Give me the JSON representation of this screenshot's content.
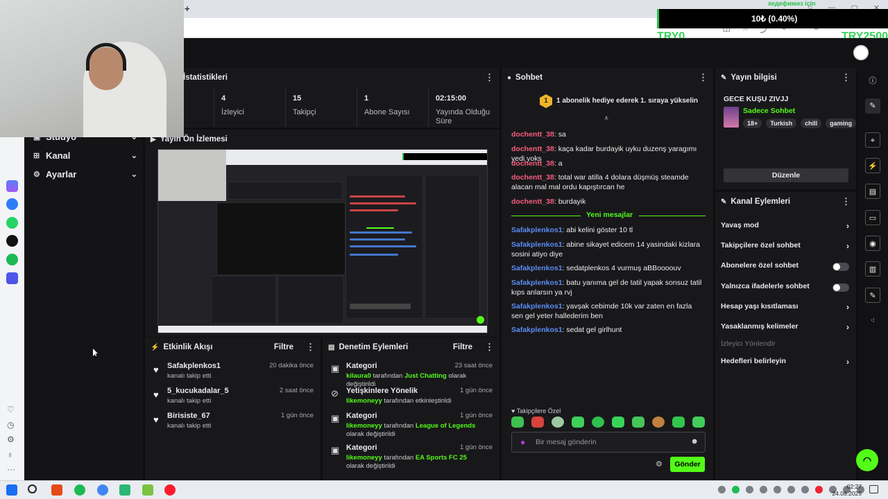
{
  "overlay": {
    "goal_label": "хедефимиз için",
    "amount": "10₺ (0.40%)",
    "min": "TRY0",
    "max": "TRY2500"
  },
  "nav": {
    "items": [
      {
        "label": "Studyo"
      },
      {
        "label": "Kanal"
      },
      {
        "label": "Ayarlar"
      }
    ]
  },
  "stats": {
    "title": "İstatistikleri",
    "items": [
      {
        "value": "4",
        "label": "İzleyici"
      },
      {
        "value": "15",
        "label": "Takipçi"
      },
      {
        "value": "1",
        "label": "Abone Sayısı"
      },
      {
        "value": "02:15:00",
        "label": "Yayında Olduğu Süre"
      }
    ]
  },
  "preview": {
    "title": "Yayın Ön İzlemesi"
  },
  "activity": {
    "title": "Etkinlik Akışı",
    "filter": "Filtre",
    "items": [
      {
        "name": "Safakplenkos1",
        "sub": "kanalı takip etti",
        "time": "20 dakika önce"
      },
      {
        "name": "5_kucukadalar_5",
        "sub": "kanalı takip etti",
        "time": "2 saat önce"
      },
      {
        "name": "Birisiste_67",
        "sub": "kanalı takip etti",
        "time": "1 gün önce"
      }
    ]
  },
  "moderation": {
    "title": "Denetim Eylemleri",
    "filter": "Filtre",
    "items": [
      {
        "title": "Kategori",
        "user": "kilaura0",
        "mid": "tarafından",
        "target": "Just Chatting",
        "end": "olarak değiştirildi",
        "time": "23 saat önce"
      },
      {
        "title": "Yetişkinlere Yönelik",
        "user": "likemoneyy",
        "mid": "tarafından etkinleştirildi",
        "target": "",
        "end": "",
        "time": "1 gün önce"
      },
      {
        "title": "Kategori",
        "user": "likemoneyy",
        "mid": "tarafından",
        "target": "League of Legends",
        "end": "olarak değiştirildi",
        "time": "1 gün önce"
      },
      {
        "title": "Kategori",
        "user": "likemoneyy",
        "mid": "tarafından",
        "target": "EA Sports FC 25",
        "end": "olarak değiştirildi",
        "time": "1 gün önce"
      }
    ]
  },
  "chat": {
    "title": "Sohbet",
    "gift_count": "1",
    "gift_text": "1 abonelik hediye ederek 1. sıraya yükselin",
    "new_messages": "Yeni mesajlar",
    "messages_old": [
      {
        "user": "dochentt_38",
        "text": ": sa"
      },
      {
        "user": "dochentt_38",
        "text": ": kaça kadar burdayik uyku duzenş yaragımı yedi yoks"
      },
      {
        "user": "dochentt_38",
        "text": ": a"
      },
      {
        "user": "dochentt_38",
        "text": ": total war atilla 4 dolara düşmüş steamde alacan mal mal ordu kapıştırcan he"
      },
      {
        "user": "dochentt_38",
        "text": ": burdayik"
      }
    ],
    "messages_new": [
      {
        "user": "Safakplenkos1",
        "text": ": abi kelini göster 10 tl"
      },
      {
        "user": "Safakplenkos1",
        "text": ": abine sikayet edicem 14 yasindaki kizlara sosini atiyo diye"
      },
      {
        "user": "Safakplenkos1",
        "text": ": sedatplenkos 4 vurmuş aBBoooouv"
      },
      {
        "user": "Safakplenkos1",
        "text": ": batu yanıma gel de tatil yapak sonsuz tatil kıps anlarsın ya rvj"
      },
      {
        "user": "Safakplenkos1",
        "text": ": yavşak cebimde 10k var zaten en fazla sen gel yeter hallederim ben"
      },
      {
        "user": "Safakplenkos1",
        "text": ": sedat gel girlhunt"
      }
    ],
    "emote_label": "Takipçilere Özel",
    "placeholder": "Bir mesaj gönderin",
    "send": "Gönder"
  },
  "stream_info": {
    "title": "Yayın bilgisi",
    "stream_title": "GECE KUŞU ZIVJJ",
    "category": "Sadece Sohbet",
    "tags": [
      "18+",
      "Turkish",
      "chill",
      "gaming"
    ],
    "edit": "Düzenle"
  },
  "channel_actions": {
    "title": "Kanal Eylemleri",
    "items": [
      {
        "label": "Yavaş mod",
        "kind": "arrow"
      },
      {
        "label": "Takipçilere özel sohbet",
        "kind": "arrow"
      },
      {
        "label": "Abonelere özel sohbet",
        "kind": "toggle"
      },
      {
        "label": "Yalnızca ifadelerle sohbet",
        "kind": "toggle"
      },
      {
        "label": "Hesap yaşı kısıtlaması",
        "kind": "arrow"
      },
      {
        "label": "Yasaklanmış kelimeler",
        "kind": "arrow"
      },
      {
        "label": "İzleyici Yönlendir",
        "kind": "dim"
      },
      {
        "label": "Hedefleri belirleyin",
        "kind": "arrow"
      }
    ]
  },
  "taskbar": {
    "time": "02:27",
    "date": "24.08.2025"
  },
  "colors": {
    "accent": "#53fc18",
    "chat_user_red": "#f65d7e",
    "chat_user_blue": "#5b8cf5"
  }
}
